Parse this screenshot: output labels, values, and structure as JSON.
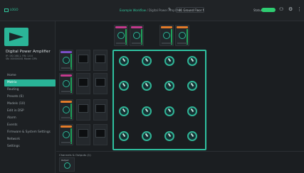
{
  "app": {
    "logo_text": "LOGO"
  },
  "header": {
    "breadcrumb_link": "Example Workflow",
    "breadcrumb_sep": " / ",
    "breadcrumb_current": "Digital Power Amplifier",
    "device_select": "01 Ground Floor MAIN",
    "status_label": "Status",
    "status_toggle": "online"
  },
  "sidebar": {
    "device_title": "Digital Power Amplifier",
    "meta_line1": "IP: 192.168.1.   FW: 1.0.0",
    "meta_line2": "SN: 000000001   Model: DPA",
    "items": [
      {
        "label": "Home"
      },
      {
        "label": "Matrix"
      },
      {
        "label": "Routing"
      },
      {
        "label": "Presets (6)"
      },
      {
        "label": "Models (10)"
      },
      {
        "label": "Edit in DSP"
      },
      {
        "label": "Alarm"
      },
      {
        "label": "Events"
      },
      {
        "label": "Firmware & System Settings"
      },
      {
        "label": "Network"
      },
      {
        "label": "Settings"
      }
    ]
  },
  "main": {
    "bottom_title": "Channels & Outputs (1)",
    "bottom_card_label": "Output",
    "colors": {
      "accent": "#2fc1a0",
      "meter": "#1fa35a",
      "pink": "#c23a8c",
      "orange": "#e27b2a",
      "purple": "#7b4fc7"
    }
  }
}
